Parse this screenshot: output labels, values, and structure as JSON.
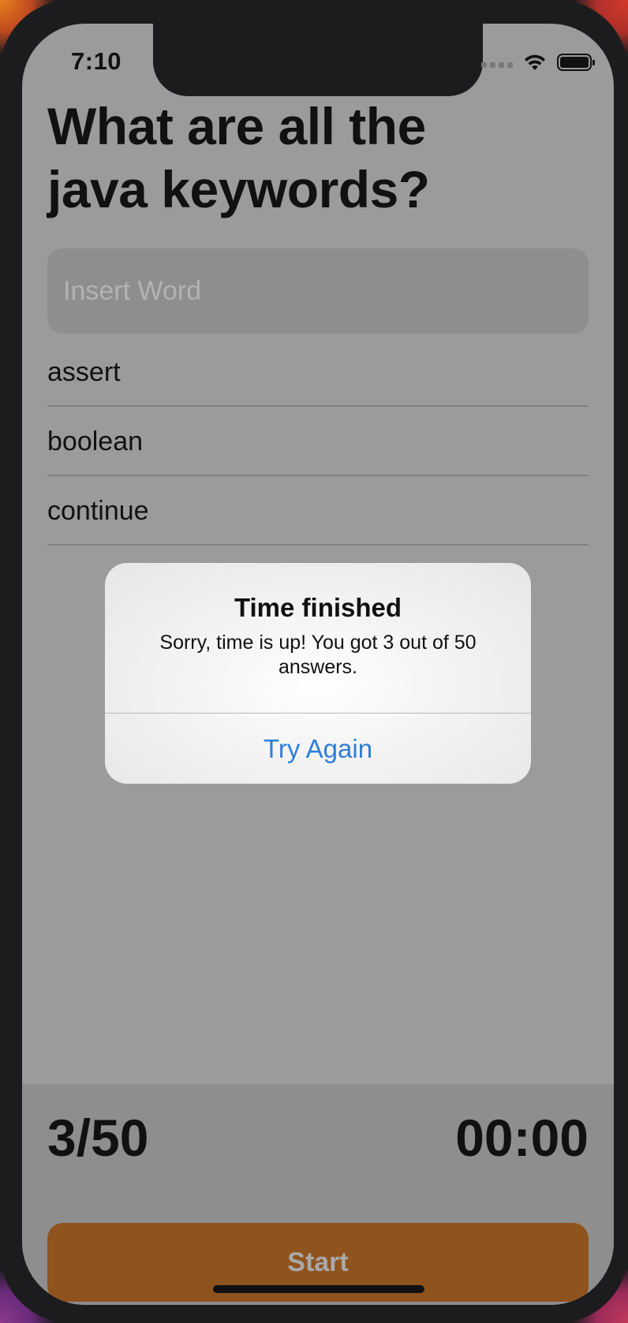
{
  "status_bar": {
    "time": "7:10",
    "signal_icon": "cellular-signal-icon",
    "wifi_icon": "wifi-icon",
    "battery_icon": "battery-icon"
  },
  "question": {
    "title": "What are all the java keywords?"
  },
  "input": {
    "placeholder": "Insert Word",
    "value": ""
  },
  "answers": [
    "assert",
    "boolean",
    "continue"
  ],
  "footer": {
    "score": "3/50",
    "timer": "00:00",
    "start_label": "Start"
  },
  "alert": {
    "title": "Time finished",
    "message": "Sorry, time is up! You got 3 out of 50 answers.",
    "action_label": "Try Again"
  },
  "colors": {
    "accent": "#2f7fd9",
    "start_button": "#8f531e",
    "overlay_background": "#9b9b9b"
  }
}
